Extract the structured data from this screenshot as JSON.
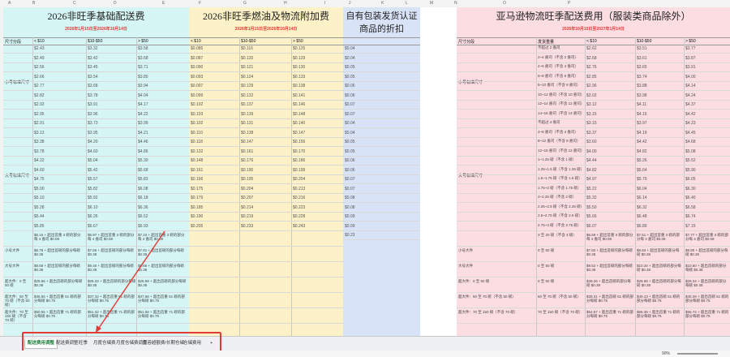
{
  "columns": [
    "A",
    "B",
    "C",
    "D",
    "E",
    "F",
    "G",
    "H",
    "I",
    "J",
    "K",
    "L",
    "M",
    "N",
    "O",
    "P"
  ],
  "panels": [
    {
      "id": "base",
      "title": "2026非旺季基础配送费",
      "subtitle": "2026年1月15日至2026年10月14日",
      "headers": [
        "尺寸分段",
        "< $10",
        "$10-$50",
        "> $50"
      ],
      "groups": [
        {
          "label": "小号标准尺寸",
          "rows": [
            [
              "$2.43",
              "$3.32",
              "$3.58"
            ],
            [
              "$2.49",
              "$3.42",
              "$3.68"
            ],
            [
              "$2.56",
              "$3.45",
              "$3.71"
            ],
            [
              "$2.66",
              "$3.54",
              "$3.80"
            ],
            [
              "$2.77",
              "$3.68",
              "$3.94"
            ],
            [
              "$2.82",
              "$3.78",
              "$4.04"
            ],
            [
              "$2.92",
              "$3.91",
              "$4.17"
            ],
            [
              "$2.95",
              "$3.96",
              "$4.22"
            ]
          ]
        },
        {
          "label": "大号标准尺寸",
          "rows": [
            [
              "$2.91",
              "$3.73",
              "$3.99"
            ],
            [
              "$3.13",
              "$3.95",
              "$4.21"
            ],
            [
              "$3.38",
              "$4.20",
              "$4.46"
            ],
            [
              "$3.78",
              "$4.60",
              "$4.86"
            ],
            [
              "$4.22",
              "$5.04",
              "$5.30"
            ],
            [
              "$4.60",
              "$5.42",
              "$5.68"
            ],
            [
              "$4.75",
              "$5.57",
              "$5.83"
            ],
            [
              "$5.00",
              "$5.82",
              "$6.08"
            ],
            [
              "$5.10",
              "$5.92",
              "$6.18"
            ],
            [
              "$5.28",
              "$6.10",
              "$6.36"
            ],
            [
              "$5.44",
              "$6.26",
              "$6.52"
            ],
            [
              "$5.85",
              "$6.67",
              "$6.93"
            ]
          ]
        }
      ]
    },
    {
      "id": "fuel",
      "title": "2026非旺季燃油及物流附加费",
      "subtitle": "2026年1月15日至2026年10月14日",
      "headers": [
        "< $10",
        "$10-$50",
        "> $50"
      ],
      "rows": [
        [
          "$0.085",
          "$0.116",
          "$0.125"
        ],
        [
          "$0.087",
          "$0.120",
          "$0.129"
        ],
        [
          "$0.090",
          "$0.121",
          "$0.130"
        ],
        [
          "$0.093",
          "$0.124",
          "$0.133"
        ],
        [
          "$0.097",
          "$0.129",
          "$0.138"
        ],
        [
          "$0.099",
          "$0.132",
          "$0.141"
        ],
        [
          "$0.102",
          "$0.137",
          "$0.146"
        ],
        [
          "$0.103",
          "$0.139",
          "$0.148"
        ],
        [
          "$0.102",
          "$0.131",
          "$0.140"
        ],
        [
          "$0.110",
          "$0.138",
          "$0.147"
        ],
        [
          "$0.118",
          "$0.147",
          "$0.156"
        ],
        [
          "$0.132",
          "$0.161",
          "$0.170"
        ],
        [
          "$0.148",
          "$0.176",
          "$0.186"
        ],
        [
          "$0.161",
          "$0.190",
          "$0.199"
        ],
        [
          "$0.166",
          "$0.195",
          "$0.204"
        ],
        [
          "$0.175",
          "$0.204",
          "$0.213"
        ],
        [
          "$0.179",
          "$0.207",
          "$0.216"
        ],
        [
          "$0.185",
          "$0.214",
          "$0.223"
        ],
        [
          "$0.190",
          "$0.219",
          "$0.228"
        ],
        [
          "$0.205",
          "$0.233",
          "$0.243"
        ]
      ]
    },
    {
      "id": "discount",
      "title": "自有包装发货认证商品的折扣",
      "rows": [
        "$0.04",
        "$0.04",
        "$0.05",
        "$0.05",
        "$0.06",
        "$0.06",
        "$0.07",
        "$0.07",
        "$0.04",
        "$0.04",
        "$0.05",
        "$0.05",
        "$0.06",
        "$0.06",
        "$0.07",
        "$0.07",
        "$0.08",
        "$0.08",
        "$0.09",
        "$0.09",
        "$0.23"
      ]
    },
    {
      "id": "peak",
      "title": "亚马逊物流旺季配送费用（服装类商品除外）",
      "subtitle": "2026年10月15日至2027年1月14日",
      "headers": [
        "尺寸分段",
        "发货重量",
        "< $10",
        "$10-$50",
        "> $50"
      ],
      "groups": [
        {
          "label": "小号标准尺寸",
          "rows": [
            [
              "不超过 2 盎司",
              "$2.62",
              "$3.51",
              "$3.77"
            ],
            [
              "2~4 盎司（不含 2 盎司）",
              "$2.68",
              "$3.61",
              "$3.87"
            ],
            [
              "4~6 盎司（不含 4 盎司）",
              "$2.76",
              "$3.65",
              "$3.91"
            ],
            [
              "6~8 盎司（不含 6 盎司）",
              "$2.85",
              "$3.74",
              "$4.00"
            ],
            [
              "8~10 盎司（不含 8 盎司）",
              "$2.96",
              "$3.88",
              "$4.14"
            ],
            [
              "10~12 盎司（不含 10 盎司）",
              "$3.02",
              "$3.98",
              "$4.24"
            ],
            [
              "12~14 盎司（不含 12 盎司）",
              "$3.12",
              "$4.11",
              "$4.37"
            ],
            [
              "14~16 盎司（不含 14 盎司）",
              "$3.15",
              "$4.16",
              "$4.42"
            ]
          ]
        },
        {
          "label": "大号标准尺寸",
          "rows": [
            [
              "不超过 4 盎司",
              "$3.15",
              "$3.97",
              "$4.23"
            ],
            [
              "4~8 盎司（不含 4 盎司）",
              "$3.37",
              "$4.19",
              "$4.45"
            ],
            [
              "8~12 盎司（不含 8 盎司）",
              "$3.60",
              "$4.42",
              "$4.68"
            ],
            [
              "12~16 盎司（不含 12 盎司）",
              "$4.00",
              "$4.82",
              "$5.08"
            ],
            [
              "1~1.25 磅（不含 1 磅）",
              "$4.44",
              "$5.26",
              "$5.52"
            ],
            [
              "1.25~1.5 磅（不含 1.25 磅）",
              "$4.82",
              "$5.64",
              "$5.90"
            ],
            [
              "1.5~1.75 磅（不含 1.5 磅）",
              "$4.97",
              "$5.79",
              "$6.05"
            ],
            [
              "1.75~2 磅（不含 1.75 磅）",
              "$5.22",
              "$6.04",
              "$6.30"
            ],
            [
              "2~2.25 磅（不含 2 磅）",
              "$5.32",
              "$6.14",
              "$6.40"
            ],
            [
              "2.25~2.5 磅（不含 2.25 磅）",
              "$5.50",
              "$6.32",
              "$6.58"
            ],
            [
              "2.5~2.75 磅（不含 2.5 磅）",
              "$5.66",
              "$6.48",
              "$6.74"
            ],
            [
              "2.75~3 磅（不含 2.75 磅）",
              "$6.07",
              "$6.89",
              "$7.15"
            ]
          ]
        }
      ],
      "tail": [
        {
          "label": "",
          "weight": "3 至 20 磅（不含 3 磅）",
          "a": "$6.69 + 超出首重 3 磅的部分每 4 盎司 $0.08",
          "b": "$7.51 + 超出首重 3 磅的部分每 4 盎司 $0.08",
          "c": "$7.77 + 超出首重 3 磅的部分每 4 盎司 $0.08"
        },
        {
          "label": "小号大件",
          "weight": "0 至 50 磅",
          "a": "$7.82 + 超出首磅的部分每磅 $0.38",
          "b": "$8.64 + 超出首磅的部分每磅 $0.38",
          "c": "$8.90 + 超出首磅的部分每磅 $0.38"
        },
        {
          "label": "大号大件",
          "weight": "0 至 50 磅",
          "a": "$9.52 + 超出首磅的部分每磅 $0.38",
          "b": "$10.34 + 超出首磅的部分每磅 $0.38",
          "c": "$10.60 + 超出首磅的部分每磅 $0.38"
        },
        {
          "label": "超大件：0 至 50 磅",
          "weight": "0 至 50 磅",
          "a": "$28.26 + 超出首磅的部分每磅 $0.38",
          "b": "$29.08 + 超出首磅的部分每磅 $0.38",
          "c": "$29.34 + 超出首磅的部分每磅 $0.38"
        },
        {
          "label": "超大件：50 至 70 磅（不含 50 磅）",
          "weight": "50 至 70 磅（不含 50 磅）",
          "a": "$39.31 + 超出首磅 51 磅的部分每磅 $0.75",
          "b": "$40.13 + 超出首磅 51 磅的部分每磅 $0.75",
          "c": "$40.39 + 超出首磅 51 磅的部分每磅 $0.75"
        },
        {
          "label": "超大件：70 至 150 磅（不含 70 磅）",
          "weight": "70 至 150 磅（不含 70 磅）",
          "a": "$54.57 + 超出首重 71 磅的部分每磅 $0.75",
          "b": "$55.39 + 超出首重 71 磅的部分每磅 $0.75",
          "c": "$55.74 + 超出首重 71 磅的部分每磅 $0.75"
        }
      ]
    }
  ],
  "base_tail": [
    {
      "label": "",
      "a": "$6.15 + 超出首重 3 磅的部分每 4 盎司 $0.08",
      "b": "$6.97 + 超出首重 3 磅的部分每 4 盎司 $0.08",
      "c": "$7.23 + 超出首重 3 磅的部分每 4 盎司 $0.08"
    },
    {
      "label": "小号大件",
      "a": "$6.78 + 超出首磅的部分每磅 $0.38",
      "b": "$7.55 + 超出首磅的部分每磅 $0.38",
      "c": "$7.81 + 超出首磅的部分每磅 $0.38"
    },
    {
      "label": "大号大件",
      "a": "$8.58 + 超出首磅的部分每磅 $0.38",
      "b": "$9.40 + 超出首磅的部分每磅 $0.38",
      "c": "$9.66 + 超出首磅的部分每磅 $0.38"
    },
    {
      "label": "超大件：0 至 50 磅",
      "a": "$25.56 + 超出首磅的部分每磅 $0.38",
      "b": "$26.33 + 超出首磅的部分每磅 $0.38",
      "c": "$26.59 + 超出首磅的部分每磅 $0.38"
    },
    {
      "label": "超大件：50 至 70 磅（不含 50 磅）",
      "a": "$36.55 + 超出首重 51 磅的部分每磅 $0.75",
      "b": "$37.32 + 超出首重 51 磅的部分每磅 $0.75",
      "c": "$37.58 + 超出首重 51 磅的部分每磅 $0.75"
    },
    {
      "label": "超大件：70 至 150 磅（不含 70 磅）",
      "a": "$50.55 + 超出首重 71 磅的部分每磅 $0.75",
      "b": "$51.32 + 超出首重 71 磅的部分每磅 $0.75",
      "c": "$51.58 + 超出首重 71 磅的部分每磅 $0.75"
    }
  ],
  "tabs": [
    "配送费用调整",
    "配送费调整",
    "旺季",
    "月度仓储费",
    "月度仓储费调整",
    "库容超额费/长期仓储",
    "仓储费用"
  ],
  "add_tab": "+",
  "zoom": "90%",
  "colors": {
    "base": "#d6f5f5",
    "fuel": "#fdf1c7",
    "discount": "#d9e3f7",
    "peak": "#fbdde2",
    "highlight": "#e53935"
  }
}
